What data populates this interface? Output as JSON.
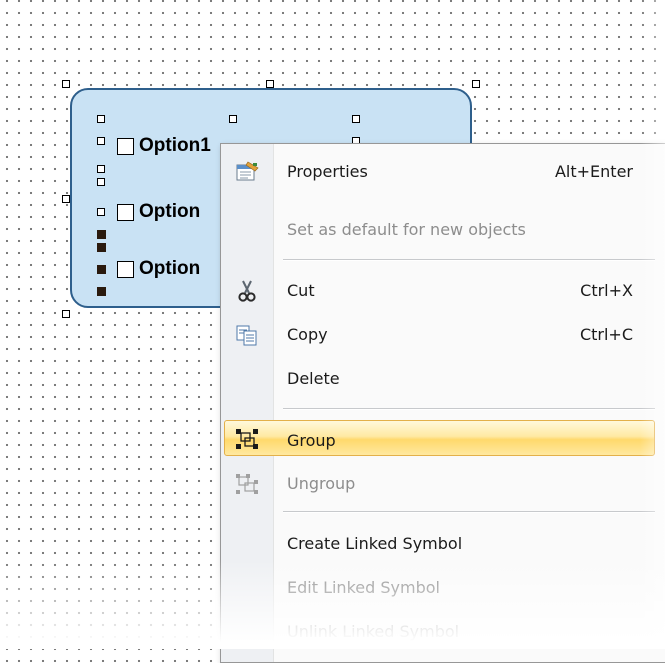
{
  "canvas": {
    "options": [
      {
        "label": "Option1"
      },
      {
        "label": "Option"
      },
      {
        "label": "Option"
      }
    ]
  },
  "context_menu": {
    "items": [
      {
        "label": "Properties",
        "shortcut": "Alt+Enter",
        "icon": "properties-icon",
        "enabled": true
      },
      {
        "label": "Set as default for new objects",
        "shortcut": "",
        "icon": "",
        "enabled": false
      },
      {
        "label": "Cut",
        "shortcut": "Ctrl+X",
        "icon": "scissors-icon",
        "enabled": true
      },
      {
        "label": "Copy",
        "shortcut": "Ctrl+C",
        "icon": "copy-icon",
        "enabled": true
      },
      {
        "label": "Delete",
        "shortcut": "",
        "icon": "",
        "enabled": true
      },
      {
        "label": "Group",
        "shortcut": "",
        "icon": "group-icon",
        "enabled": true,
        "highlighted": true
      },
      {
        "label": "Ungroup",
        "shortcut": "",
        "icon": "ungroup-icon",
        "enabled": false
      },
      {
        "label": "Create Linked Symbol",
        "shortcut": "",
        "icon": "",
        "enabled": true
      },
      {
        "label": "Edit Linked Symbol",
        "shortcut": "",
        "icon": "",
        "enabled": false
      },
      {
        "label": "Unlink Linked Symbol",
        "shortcut": "",
        "icon": "",
        "enabled": false
      }
    ]
  },
  "colors": {
    "group_fill": "#c9e2f4",
    "group_border": "#2e5f8c",
    "menu_highlight": "#ffe08a",
    "disabled_text": "#8d8d8d"
  }
}
